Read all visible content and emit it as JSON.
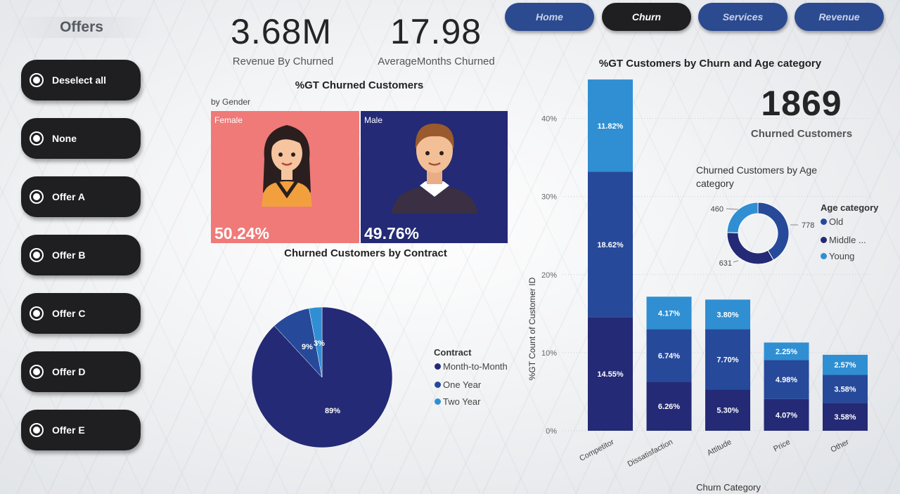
{
  "offers": {
    "title": "Offers",
    "items": [
      {
        "label": "Deselect all"
      },
      {
        "label": "None"
      },
      {
        "label": "Offer A"
      },
      {
        "label": "Offer B"
      },
      {
        "label": "Offer C"
      },
      {
        "label": "Offer D"
      },
      {
        "label": "Offer E"
      }
    ]
  },
  "kpis": {
    "revenue": {
      "value": "3.68M",
      "label": "Revenue By Churned"
    },
    "months": {
      "value": "17.98",
      "label": "AverageMonths Churned"
    },
    "churned": {
      "value": "1869",
      "label": "Churned Customers"
    }
  },
  "nav": {
    "home": "Home",
    "churn": "Churn",
    "services": "Services",
    "revenue": "Revenue",
    "active": "churn"
  },
  "gender": {
    "title": "%GT Churned Customers",
    "subtitle": "by Gender",
    "female": {
      "label": "Female",
      "pct": "50.24%",
      "color": "#ef7a78"
    },
    "male": {
      "label": "Male",
      "pct": "49.76%",
      "color": "#242a75"
    }
  },
  "contract": {
    "title": "Churned Customers by Contract",
    "legend_title": "Contract",
    "legend": [
      {
        "label": "Month-to-Month",
        "color": "#242a75"
      },
      {
        "label": "One Year",
        "color": "#26499a"
      },
      {
        "label": "Two Year",
        "color": "#2f8fd2"
      }
    ]
  },
  "age": {
    "title": "Churned Customers by Age category",
    "legend_title": "Age category",
    "legend": [
      {
        "label": "Old",
        "color": "#26499a"
      },
      {
        "label": "Middle ...",
        "color": "#242a75"
      },
      {
        "label": "Young",
        "color": "#2f8fd2"
      }
    ]
  },
  "stacked": {
    "title": "%GT Customers by Churn and Age category",
    "ylabel": "%GT Count of Customer ID",
    "xlabel": "Churn Category"
  },
  "chart_data": [
    {
      "type": "pie",
      "title": "Churned Customers by Contract",
      "categories": [
        "Month-to-Month",
        "One Year",
        "Two Year"
      ],
      "values": [
        89,
        9,
        3
      ],
      "labels": [
        "89%",
        "9%",
        "3%"
      ],
      "colors": [
        "#242a75",
        "#26499a",
        "#2f8fd2"
      ]
    },
    {
      "type": "pie",
      "title": "Churned Customers by Age category",
      "donut": true,
      "categories": [
        "Old",
        "Middle ...",
        "Young"
      ],
      "values": [
        778,
        631,
        460
      ],
      "colors": [
        "#26499a",
        "#242a75",
        "#2f8fd2"
      ]
    },
    {
      "type": "bar",
      "stacked": true,
      "title": "%GT Customers by Churn and Age category",
      "xlabel": "Churn Category",
      "ylabel": "%GT Count of Customer ID",
      "categories": [
        "Competitor",
        "Dissatisfaction",
        "Attitude",
        "Price",
        "Other"
      ],
      "ylim": [
        0,
        45
      ],
      "yticks": [
        "0%",
        "10%",
        "20%",
        "30%",
        "40%"
      ],
      "series": [
        {
          "name": "Middle ...",
          "color": "#242a75",
          "values": [
            14.55,
            6.26,
            5.3,
            4.07,
            3.58
          ],
          "labels": [
            "14.55%",
            "6.26%",
            "5.30%",
            "4.07%",
            "3.58%"
          ]
        },
        {
          "name": "Old",
          "color": "#26499a",
          "values": [
            18.62,
            6.74,
            7.7,
            4.98,
            3.58
          ],
          "labels": [
            "18.62%",
            "6.74%",
            "7.70%",
            "4.98%",
            "3.58%"
          ]
        },
        {
          "name": "Young",
          "color": "#2f8fd2",
          "values": [
            11.82,
            4.17,
            3.8,
            2.25,
            2.57
          ],
          "labels": [
            "11.82%",
            "4.17%",
            "3.80%",
            "2.25%",
            "2.57%"
          ]
        }
      ]
    }
  ]
}
